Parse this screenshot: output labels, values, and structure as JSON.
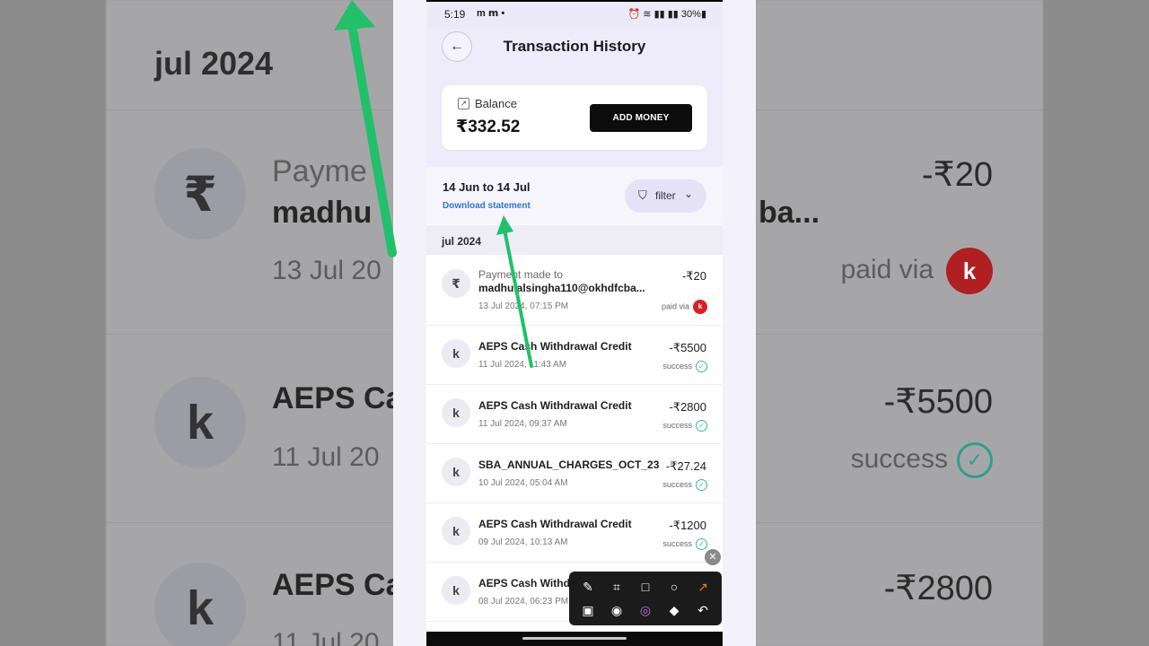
{
  "status_bar": {
    "time": "5:19",
    "right": "30%"
  },
  "header": {
    "title": "Transaction History"
  },
  "balance": {
    "label": "Balance",
    "value": "₹332.52",
    "button": "ADD MONEY"
  },
  "range": {
    "label": "14 Jun to 14 Jul",
    "download": "Download statement",
    "filter": "filter"
  },
  "month": "jul 2024",
  "transactions": [
    {
      "icon": "₹",
      "sub": "Payment made to",
      "name": "madhulalsingha110@okhdfcba...",
      "date": "13 Jul 2024, 07:15 PM",
      "amount": "-₹20",
      "status": "paid via"
    },
    {
      "icon": "k",
      "name": "AEPS Cash Withdrawal Credit",
      "date": "11 Jul 2024, 11:43 AM",
      "amount": "-₹5500",
      "status": "success"
    },
    {
      "icon": "k",
      "name": "AEPS Cash Withdrawal Credit",
      "date": "11 Jul 2024, 09:37 AM",
      "amount": "-₹2800",
      "status": "success"
    },
    {
      "icon": "k",
      "name": "SBA_ANNUAL_CHARGES_OCT_23",
      "date": "10 Jul 2024, 05:04 AM",
      "amount": "-₹27.24",
      "status": "success"
    },
    {
      "icon": "k",
      "name": "AEPS Cash Withdrawal Credit",
      "date": "09 Jul 2024, 10:13 AM",
      "amount": "-₹1200",
      "status": "success"
    },
    {
      "icon": "k",
      "name": "AEPS Cash Withdrawal Credit",
      "date": "08 Jul 2024, 06:23 PM",
      "amount": "",
      "status": ""
    }
  ],
  "background": {
    "month": "jul 2024",
    "row1": {
      "line1": "Payme",
      "line2": "madhu",
      "line2b": "ba...",
      "line3": "13 Jul 20",
      "amount": "-₹20",
      "status": "paid via"
    },
    "row2": {
      "line2": "AEPS Ca",
      "line3": "11 Jul 20",
      "amount": "-₹5500",
      "status": "success"
    },
    "row3": {
      "line2": "AEPS Ca",
      "line3": "11 Jul 20",
      "amount": "-₹2800"
    }
  },
  "colors": {
    "accent_blue": "#2d74d8",
    "arrow_green": "#22c06a",
    "badge_red": "#d81f26",
    "success_teal": "#35b8a6"
  },
  "icons": [
    "back-arrow-icon",
    "share-icon",
    "filter-icon",
    "chevron-down-icon",
    "rupee-icon",
    "k-logo-icon",
    "check-icon",
    "brush-icon",
    "crop-icon",
    "square-icon",
    "circle-icon",
    "arrow-icon",
    "mosaic-icon",
    "camera-icon",
    "color-wheel-icon",
    "eraser-icon",
    "undo-icon",
    "close-icon"
  ]
}
